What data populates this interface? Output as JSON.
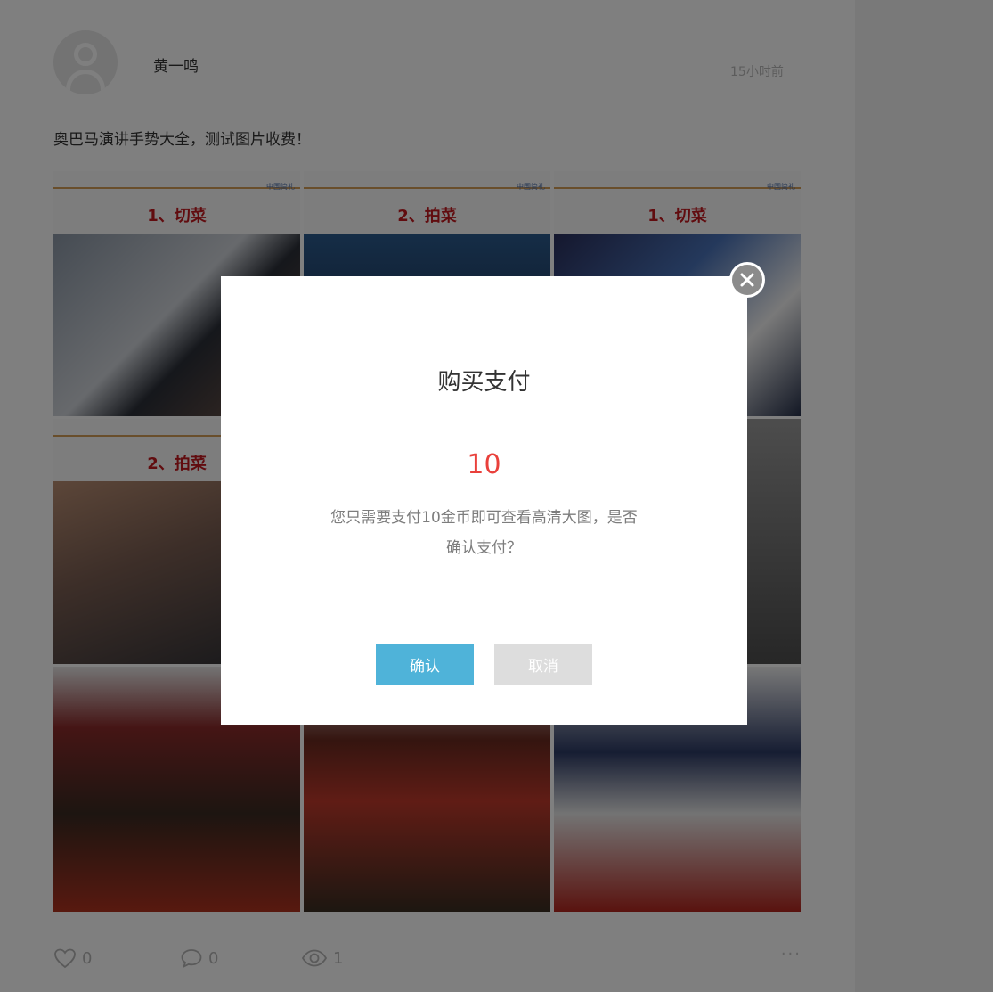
{
  "post": {
    "username": "黄一鸣",
    "timestamp": "15小时前",
    "text": "奥巴马演讲手势大全，测试图片收费！",
    "images": [
      {
        "step": "1、切菜",
        "tag": "中国简礼"
      },
      {
        "step": "2、拍菜",
        "tag": "中国简礼"
      },
      {
        "step": "1、切菜",
        "tag": "中国简礼"
      },
      {
        "step": "2、拍菜",
        "tag": ""
      },
      {
        "step": "",
        "tag": ""
      },
      {
        "step": "",
        "tag": ""
      },
      {
        "step": "",
        "tag": ""
      },
      {
        "step": "",
        "tag": ""
      },
      {
        "step": "",
        "tag": ""
      }
    ],
    "stats": {
      "likes": "0",
      "comments": "0",
      "views": "1",
      "more": "···"
    }
  },
  "modal": {
    "title": "购买支付",
    "amount": "10",
    "description": "您只需要支付10金币即可查看高清大图，是否确认支付？",
    "confirm_label": "确认",
    "cancel_label": "取消"
  },
  "icons": {
    "like": "heart-icon",
    "comment": "comment-bubble-icon",
    "views": "eye-icon",
    "close": "close-icon"
  },
  "colors": {
    "accent_red": "#e9403b",
    "confirm_button": "#4fb3d9",
    "cancel_button": "#dddddd",
    "overlay": "rgba(0,0,0,0.5)"
  }
}
